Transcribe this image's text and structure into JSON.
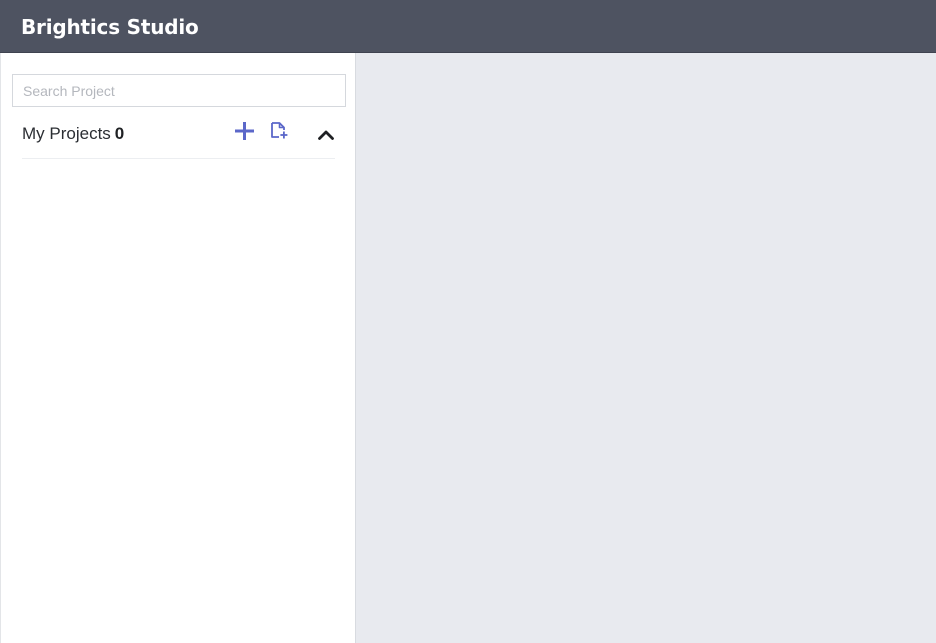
{
  "header": {
    "title": "Brightics Studio"
  },
  "sidebar": {
    "search": {
      "placeholder": "Search Project",
      "value": ""
    },
    "projects": {
      "label": "My Projects",
      "count": "0",
      "add_icon": "plus-icon",
      "import_icon": "file-add-icon",
      "collapse_icon": "chevron-up-icon"
    }
  },
  "colors": {
    "header_bg": "#4e5361",
    "accent": "#5b67c9",
    "main_bg": "#e8eaef"
  }
}
